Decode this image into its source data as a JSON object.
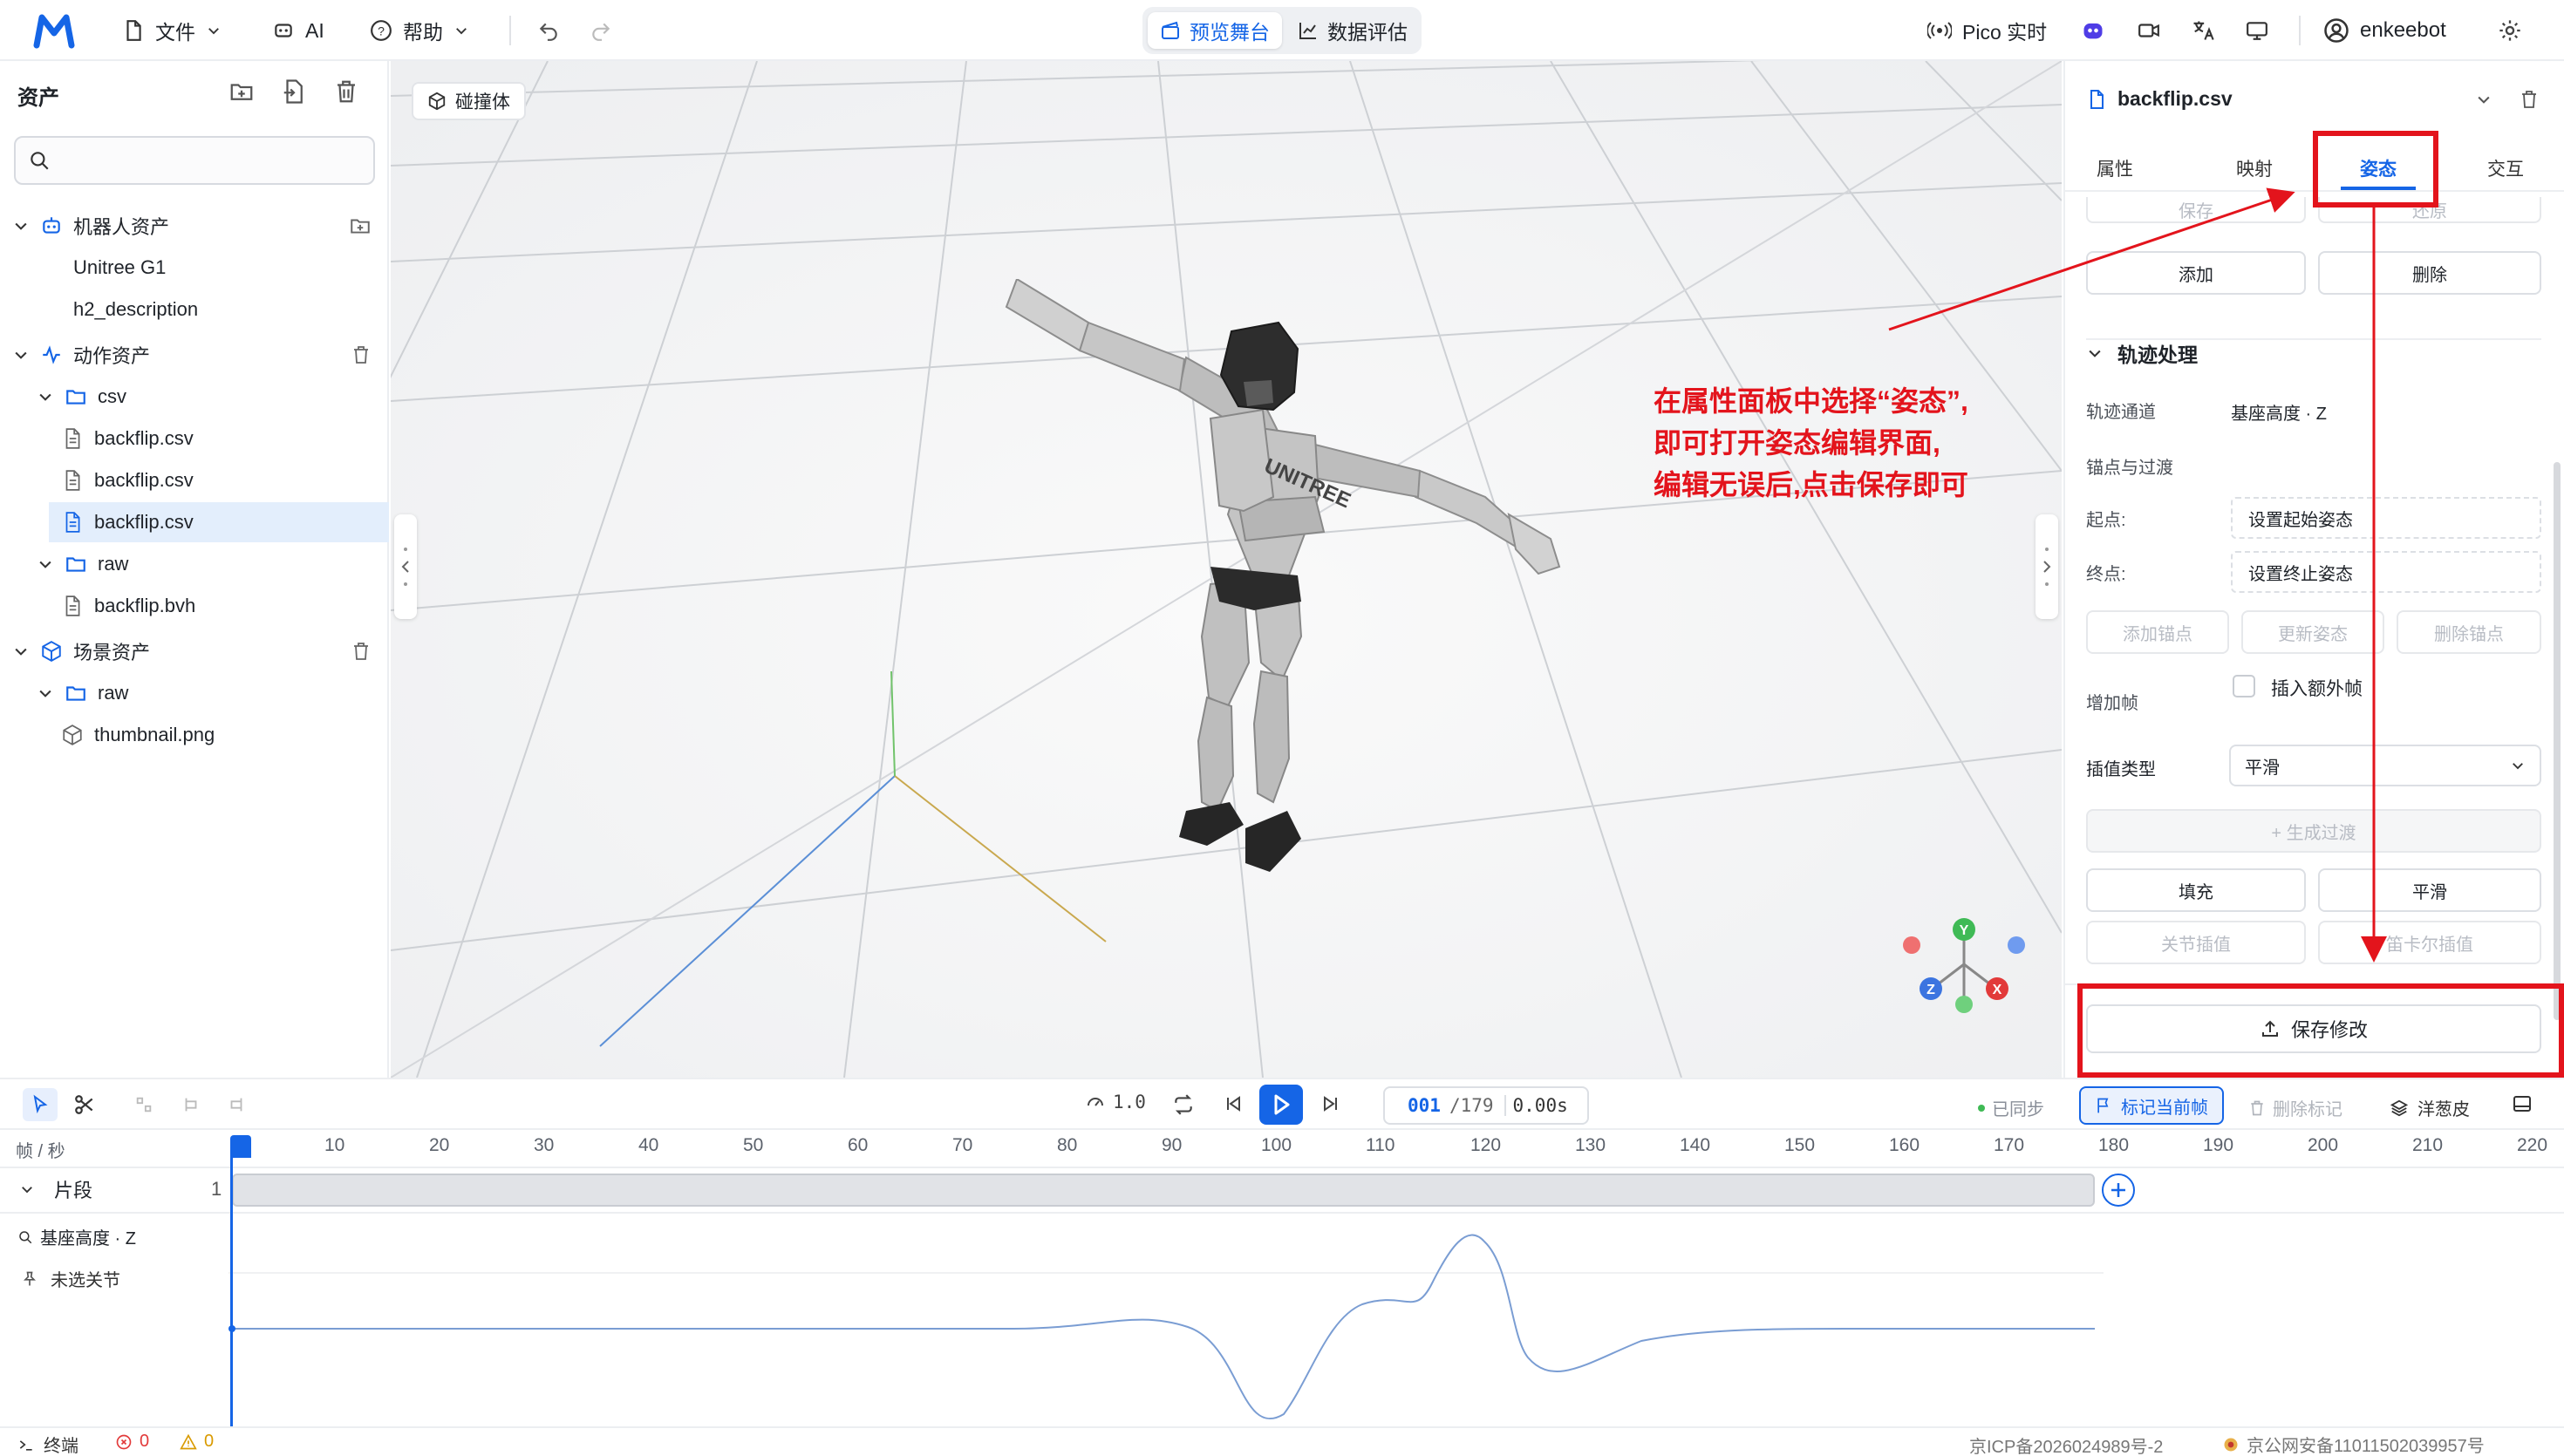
{
  "topbar": {
    "file": "文件",
    "ai": "AI",
    "help": "帮助",
    "tab_preview": "预览舞台",
    "tab_eval": "数据评估",
    "pico": "Pico 实时",
    "username": "enkeebot"
  },
  "assets": {
    "title": "资产",
    "search_placeholder": "",
    "robot_group": "机器人资产",
    "robot_items": [
      "Unitree G1",
      "h2_description"
    ],
    "motion_group": "动作资产",
    "csv_folder": "csv",
    "csv_files": [
      "backflip.csv",
      "backflip.csv",
      "backflip.csv"
    ],
    "raw_folder": "raw",
    "raw_file": "backflip.bvh",
    "scene_group": "场景资产",
    "scene_raw_folder": "raw",
    "scene_file": "thumbnail.png"
  },
  "viewport": {
    "collision_label": "碰撞体",
    "gizmo": {
      "y": "Y",
      "x": "X",
      "z": "Z"
    },
    "robot_brand": "UNITREE"
  },
  "panel": {
    "file_name": "backflip.csv",
    "tabs": [
      "属性",
      "映射",
      "姿态",
      "交互"
    ],
    "active_tab": "姿态",
    "save_btn": "保存",
    "restore_btn": "还原",
    "add_btn": "添加",
    "delete_btn": "删除",
    "traj_section": "轨迹处理",
    "traj_channel_label": "轨迹通道",
    "traj_channel_value": "基座高度 · Z",
    "anchor_label": "锚点与过渡",
    "start_label": "起点:",
    "start_value": "设置起始姿态",
    "end_label": "终点:",
    "end_value": "设置终止姿态",
    "add_anchor": "添加锚点",
    "update_pose": "更新姿态",
    "delete_anchor": "删除锚点",
    "add_frame_label": "增加帧",
    "insert_extra": "插入额外帧",
    "interp_label": "插值类型",
    "interp_value": "平滑",
    "gen_transition": "+ 生成过渡",
    "fill_btn": "填充",
    "smooth_btn": "平滑",
    "joint_interp": "关节插值",
    "cart_interp": "笛卡尔插值",
    "save_changes": "保存修改"
  },
  "annotation": {
    "lines": [
      "在属性面板中选择“姿态”,",
      "即可打开姿态编辑界面,",
      "编辑无误后,点击保存即可"
    ]
  },
  "timeline": {
    "speed": "1.0",
    "frame_current": "001",
    "frame_total": "/179",
    "time": "0.00s",
    "synced": "已同步",
    "mark_current": "标记当前帧",
    "delete_mark": "删除标记",
    "onion": "洋葱皮",
    "units": "帧 / 秒",
    "ticks": [
      "10",
      "20",
      "30",
      "40",
      "50",
      "60",
      "70",
      "80",
      "90",
      "100",
      "110",
      "120",
      "130",
      "140",
      "150",
      "160",
      "170",
      "180",
      "190",
      "200",
      "210",
      "220"
    ],
    "segment_label": "片段",
    "segment_count": "1",
    "channel": "基座高度 · Z",
    "unselected_joint": "未选关节"
  },
  "status": {
    "terminal": "终端",
    "errors": "0",
    "warnings": "0",
    "icp": "京ICP备2026024989号-2",
    "police": "京公网安备11011502039957号"
  },
  "colors": {
    "accent": "#1565e6",
    "annotation": "#e3141c"
  }
}
